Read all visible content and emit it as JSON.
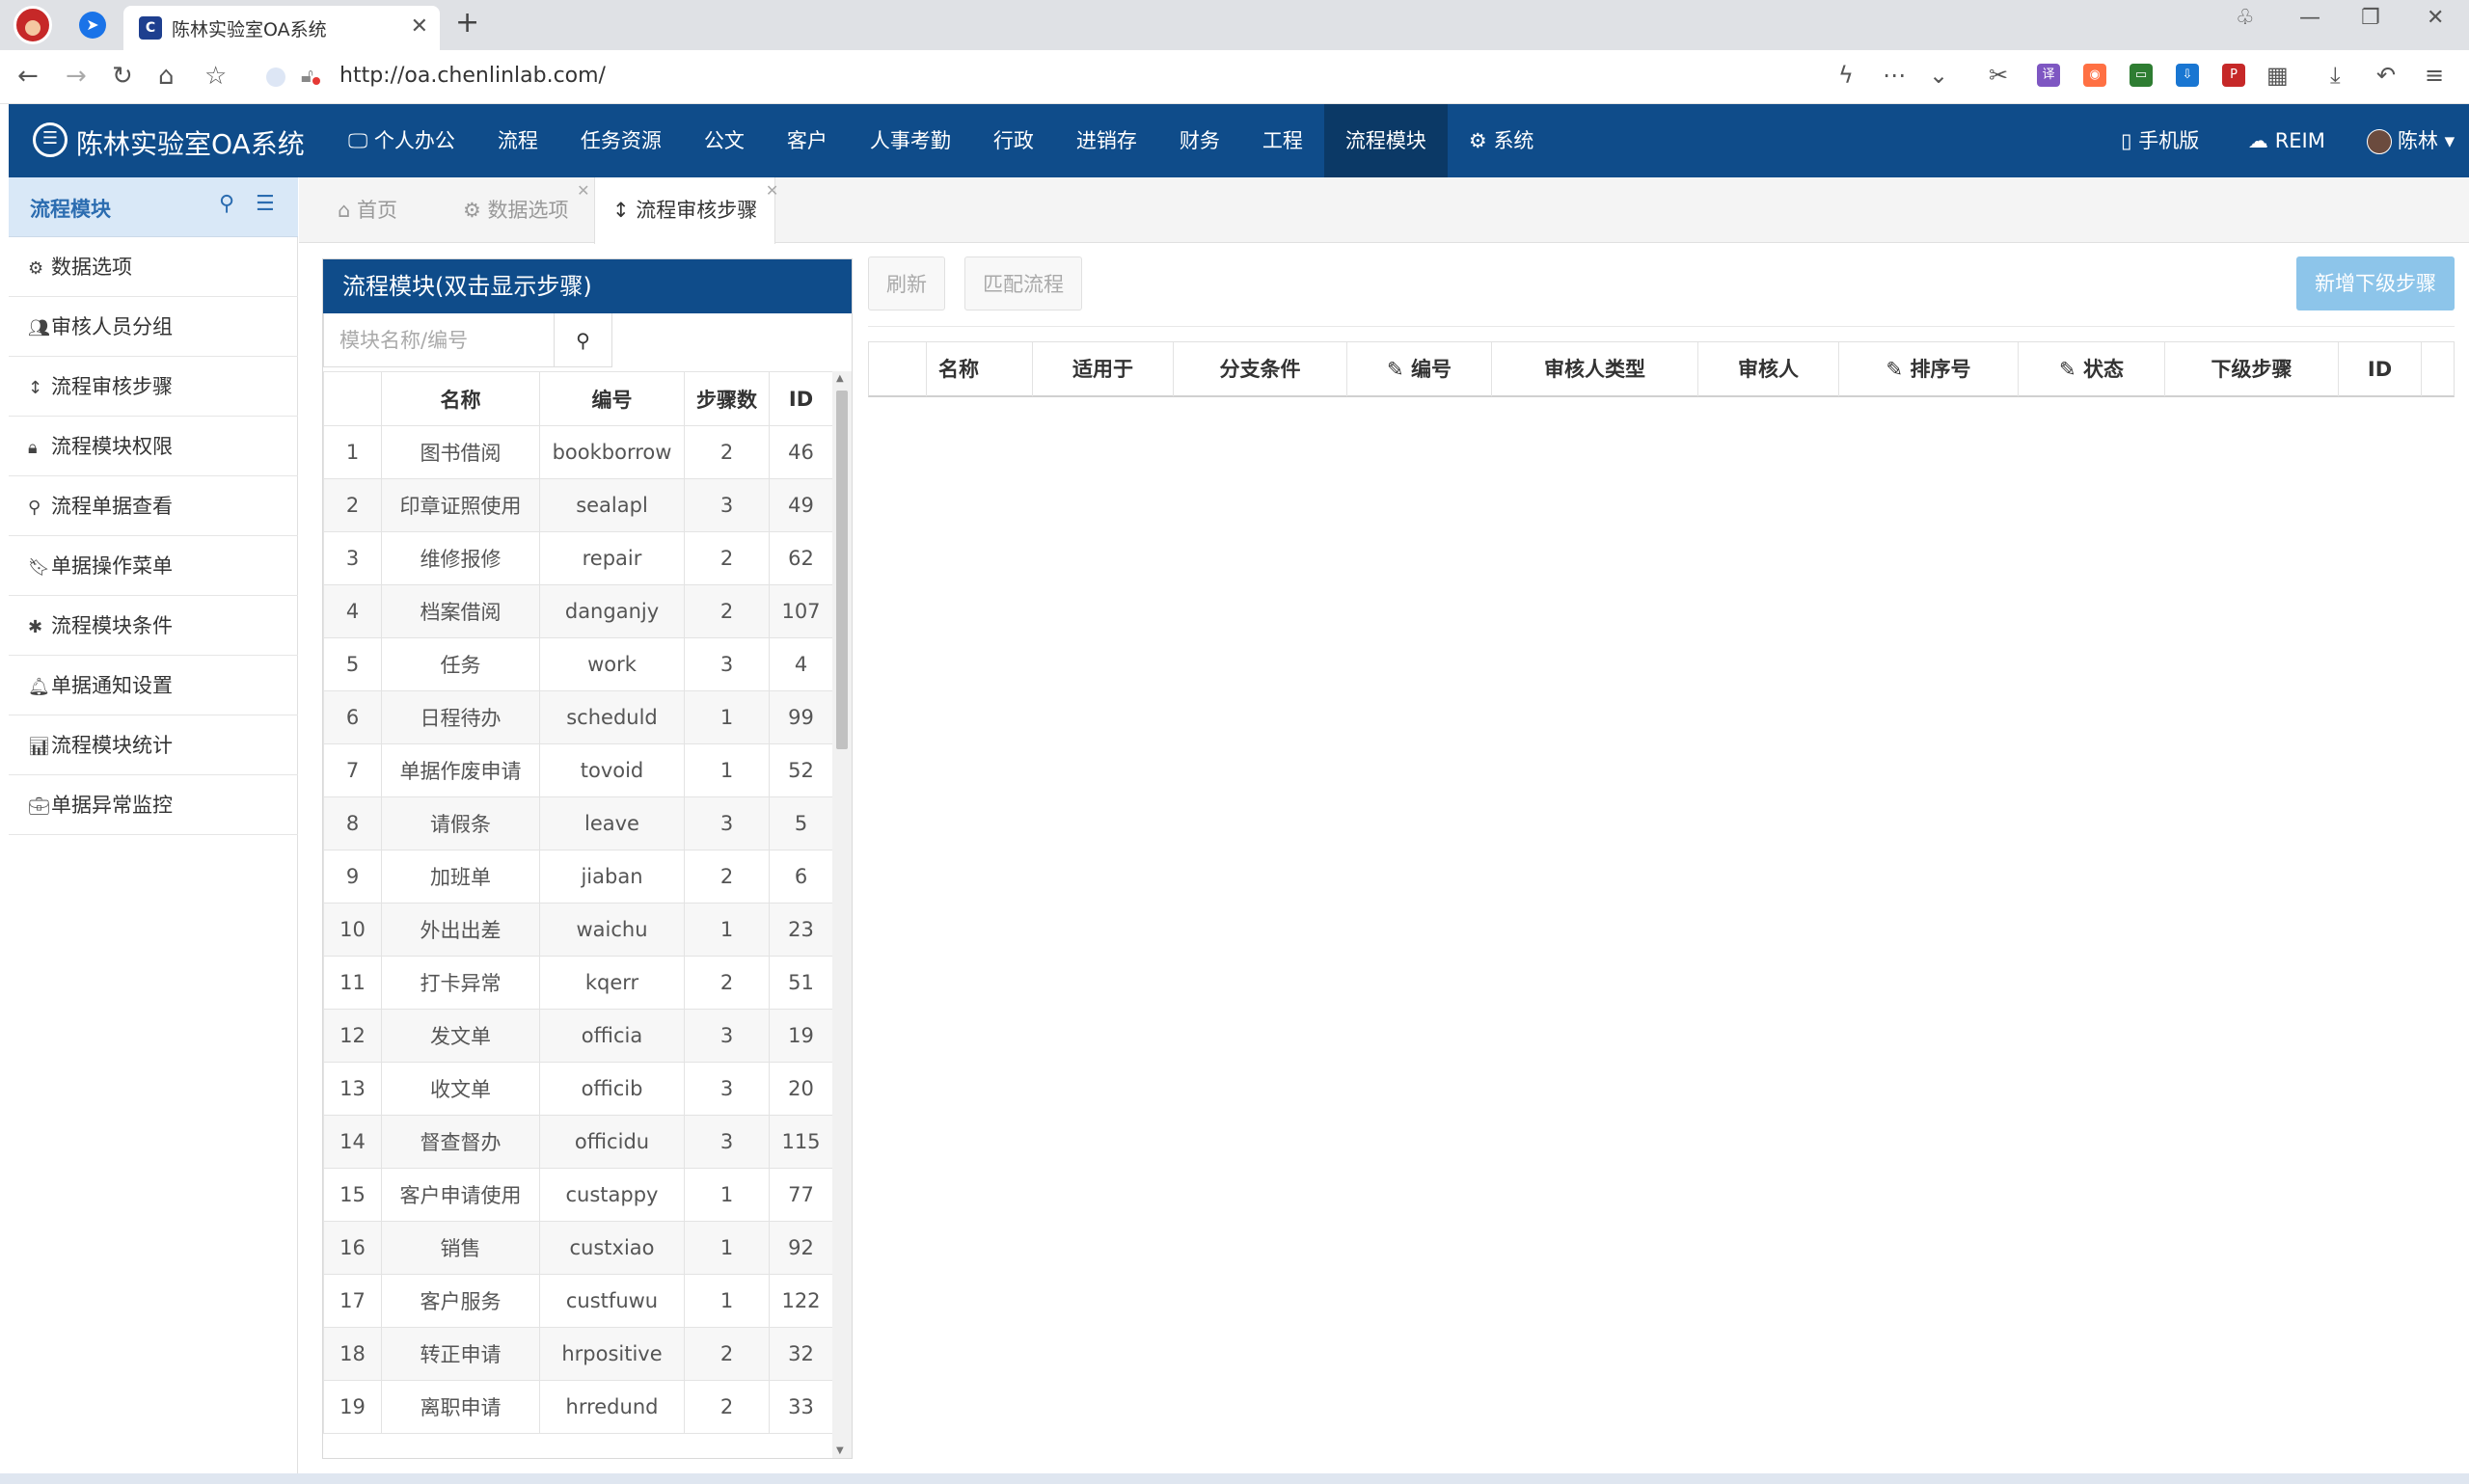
{
  "browser": {
    "tab_title": "陈林实验室OA系统",
    "url": "http://oa.chenlinlab.com/"
  },
  "app": {
    "title": "陈林实验室OA系统",
    "nav": [
      "个人办公",
      "流程",
      "任务资源",
      "公文",
      "客户",
      "人事考勤",
      "行政",
      "进销存",
      "财务",
      "工程",
      "流程模块",
      "系统"
    ],
    "active_nav": "流程模块",
    "mobile_label": "手机版",
    "reim_label": "REIM",
    "user_name": "陈林"
  },
  "sidebar": {
    "title": "流程模块",
    "items": [
      {
        "label": "数据选项",
        "icon": "gear-icon"
      },
      {
        "label": "审核人员分组",
        "icon": "users-icon"
      },
      {
        "label": "流程审核步骤",
        "icon": "sort-icon"
      },
      {
        "label": "流程模块权限",
        "icon": "lock-icon"
      },
      {
        "label": "流程单据查看",
        "icon": "search-icon"
      },
      {
        "label": "单据操作菜单",
        "icon": "bookmark-icon"
      },
      {
        "label": "流程模块条件",
        "icon": "asterisk-icon"
      },
      {
        "label": "单据通知设置",
        "icon": "bell-icon"
      },
      {
        "label": "流程模块统计",
        "icon": "chart-icon"
      },
      {
        "label": "单据异常监控",
        "icon": "briefcase-icon"
      }
    ]
  },
  "content_tabs": [
    {
      "label": "首页",
      "icon": "home-icon"
    },
    {
      "label": "数据选项",
      "icon": "gear-icon"
    },
    {
      "label": "流程审核步骤",
      "icon": "sort-icon"
    }
  ],
  "modules_panel": {
    "title": "流程模块(双击显示步骤)",
    "search_placeholder": "模块名称/编号",
    "columns": [
      "",
      "名称",
      "编号",
      "步骤数",
      "ID"
    ],
    "rows": [
      [
        "1",
        "图书借阅",
        "bookborrow",
        "2",
        "46"
      ],
      [
        "2",
        "印章证照使用",
        "sealapl",
        "3",
        "49"
      ],
      [
        "3",
        "维修报修",
        "repair",
        "2",
        "62"
      ],
      [
        "4",
        "档案借阅",
        "danganjy",
        "2",
        "107"
      ],
      [
        "5",
        "任务",
        "work",
        "3",
        "4"
      ],
      [
        "6",
        "日程待办",
        "scheduld",
        "1",
        "99"
      ],
      [
        "7",
        "单据作废申请",
        "tovoid",
        "1",
        "52"
      ],
      [
        "8",
        "请假条",
        "leave",
        "3",
        "5"
      ],
      [
        "9",
        "加班单",
        "jiaban",
        "2",
        "6"
      ],
      [
        "10",
        "外出出差",
        "waichu",
        "1",
        "23"
      ],
      [
        "11",
        "打卡异常",
        "kqerr",
        "2",
        "51"
      ],
      [
        "12",
        "发文单",
        "officia",
        "3",
        "19"
      ],
      [
        "13",
        "收文单",
        "officib",
        "3",
        "20"
      ],
      [
        "14",
        "督查督办",
        "officidu",
        "3",
        "115"
      ],
      [
        "15",
        "客户申请使用",
        "custappy",
        "1",
        "77"
      ],
      [
        "16",
        "销售",
        "custxiao",
        "1",
        "92"
      ],
      [
        "17",
        "客户服务",
        "custfuwu",
        "1",
        "122"
      ],
      [
        "18",
        "转正申请",
        "hrpositive",
        "2",
        "32"
      ],
      [
        "19",
        "离职申请",
        "hrredund",
        "2",
        "33"
      ]
    ]
  },
  "toolbar": {
    "refresh_label": "刷新",
    "match_label": "匹配流程",
    "add_label": "新增下级步骤"
  },
  "steps_table": {
    "columns": [
      {
        "label": "名称",
        "editable": false
      },
      {
        "label": "适用于",
        "editable": false
      },
      {
        "label": "分支条件",
        "editable": false
      },
      {
        "label": "编号",
        "editable": true
      },
      {
        "label": "审核人类型",
        "editable": false
      },
      {
        "label": "审核人",
        "editable": false
      },
      {
        "label": "排序号",
        "editable": true
      },
      {
        "label": "状态",
        "editable": true
      },
      {
        "label": "下级步骤",
        "editable": false
      },
      {
        "label": "ID",
        "editable": false
      }
    ]
  },
  "colors": {
    "header_bg": "#0f4c8a",
    "header_active": "#0b3966",
    "sidebar_head": "#d9e8f7",
    "primary_button": "#8dc5ea"
  }
}
